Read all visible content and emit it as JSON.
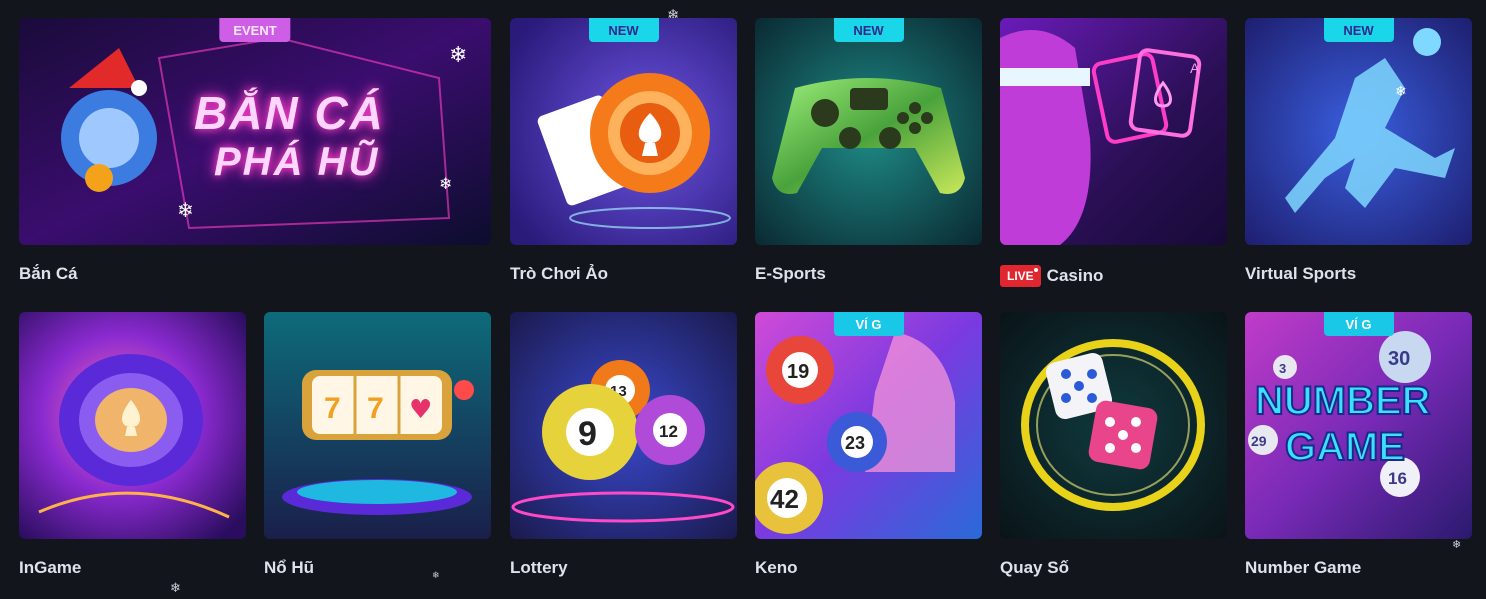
{
  "games": [
    {
      "id": "ban-ca",
      "label": "Bắn Cá",
      "badge": "EVENT",
      "banner_line1": "BẮN CÁ",
      "banner_line2": "PHÁ HŨ"
    },
    {
      "id": "tro-choi-ao",
      "label": "Trò Chơi Ảo",
      "badge": "NEW"
    },
    {
      "id": "e-sports",
      "label": "E-Sports",
      "badge": "NEW"
    },
    {
      "id": "casino",
      "label": "Casino",
      "live": "LIVE",
      "card_letter": "A"
    },
    {
      "id": "virtual-sports",
      "label": "Virtual Sports",
      "badge": "NEW"
    },
    {
      "id": "ingame",
      "label": "InGame"
    },
    {
      "id": "no-hu",
      "label": "Nổ Hũ",
      "reel": [
        "7",
        "7",
        "♥"
      ]
    },
    {
      "id": "lottery",
      "label": "Lottery",
      "balls": [
        "13",
        "9",
        "12"
      ]
    },
    {
      "id": "keno",
      "label": "Keno",
      "badge": "VÍ G",
      "balls": [
        "19",
        "23",
        "42"
      ]
    },
    {
      "id": "quay-so",
      "label": "Quay Số"
    },
    {
      "id": "number-game",
      "label": "Number Game",
      "badge": "VÍ G",
      "art_line1": "NUMBER",
      "art_line2": "GAME",
      "balls": [
        "30",
        "3",
        "29",
        "16"
      ]
    }
  ],
  "colors": {
    "background": "#12151c",
    "label": "#dfe2ea",
    "badge_new": "#19d6e8",
    "badge_event": "#cf5ee6",
    "live": "#e0262f"
  }
}
